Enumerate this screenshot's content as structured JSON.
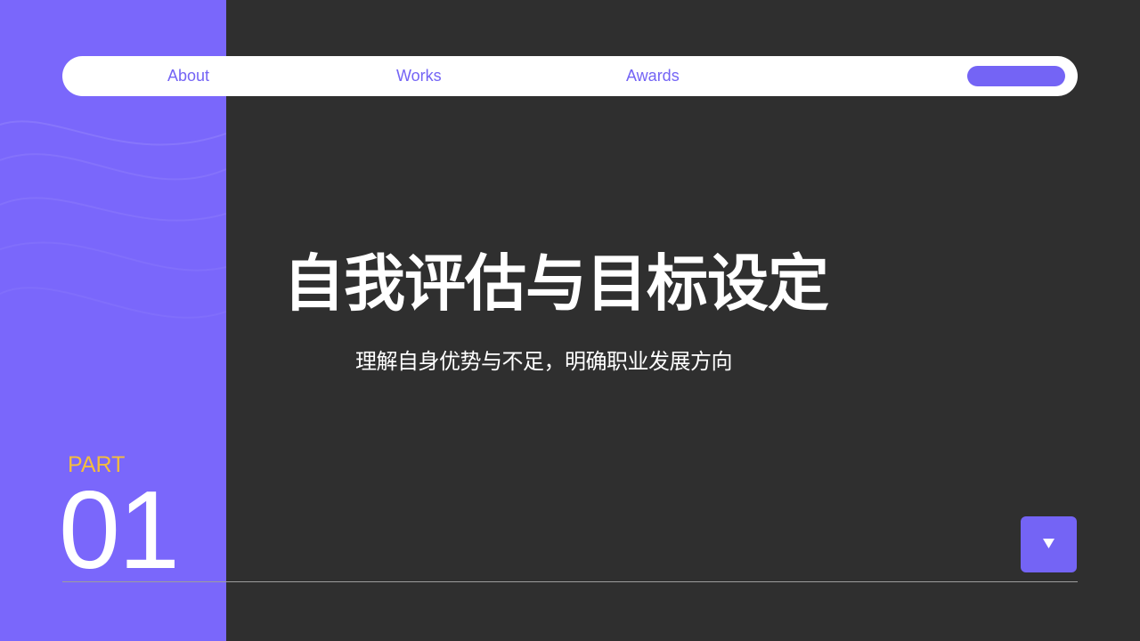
{
  "nav": {
    "items": [
      {
        "label": "About"
      },
      {
        "label": "Works"
      },
      {
        "label": "Awards"
      }
    ]
  },
  "title": "自我评估与目标设定",
  "subtitle": "理解自身优势与不足，明确职业发展方向",
  "part": {
    "label": "PART",
    "number": "01"
  },
  "icons": {
    "next_button": "triangle-down-icon"
  },
  "colors": {
    "accent": "#7464f5",
    "panel": "#7a67fb",
    "background": "#2f2f2f",
    "part_label": "#f4bd3d",
    "text": "#ffffff"
  }
}
